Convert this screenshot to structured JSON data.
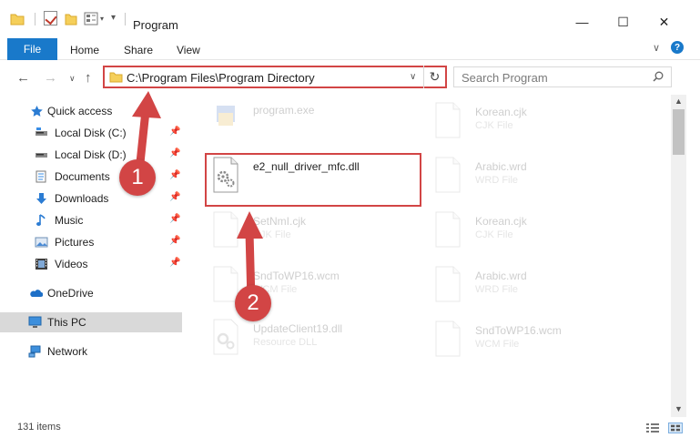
{
  "window": {
    "title": "Program",
    "minimize_glyph": "—",
    "maximize_glyph": "☐",
    "close_glyph": "✕"
  },
  "ribbon": {
    "tabs": [
      "File",
      "Home",
      "Share",
      "View"
    ],
    "help_glyph": "?"
  },
  "address": {
    "path": "C:\\Program Files\\Program Directory",
    "search_placeholder": "Search Program"
  },
  "nav": {
    "items": [
      {
        "label": "Quick access",
        "icon": "star-icon"
      },
      {
        "label": "Local Disk (C:)",
        "icon": "drive-icon",
        "pinned": true
      },
      {
        "label": "Local Disk (D:)",
        "icon": "drive-icon",
        "pinned": true
      },
      {
        "label": "Documents",
        "icon": "documents-icon",
        "pinned": true
      },
      {
        "label": "Downloads",
        "icon": "downloads-icon",
        "pinned": true
      },
      {
        "label": "Music",
        "icon": "music-icon",
        "pinned": true
      },
      {
        "label": "Pictures",
        "icon": "pictures-icon",
        "pinned": true
      },
      {
        "label": "Videos",
        "icon": "videos-icon",
        "pinned": true
      },
      {
        "label": "OneDrive",
        "icon": "onedrive-icon"
      },
      {
        "label": "This PC",
        "icon": "this-pc-icon",
        "selected": true
      },
      {
        "label": "Network",
        "icon": "network-icon"
      }
    ]
  },
  "files": {
    "col1": [
      {
        "name": "program.exe",
        "type": ""
      },
      {
        "name": "e2_null_driver_mfc.dll",
        "type": ""
      },
      {
        "name": "SetNmI.cjk",
        "type": "CJK File"
      },
      {
        "name": "SndToWP16.wcm",
        "type": "WCM File"
      },
      {
        "name": "UpdateClient19.dll",
        "type": "Resource DLL"
      }
    ],
    "col2": [
      {
        "name": "Korean.cjk",
        "type": "CJK File"
      },
      {
        "name": "Arabic.wrd",
        "type": "WRD File"
      },
      {
        "name": "Korean.cjk",
        "type": "CJK File"
      },
      {
        "name": "Arabic.wrd",
        "type": "WRD File"
      },
      {
        "name": "SndToWP16.wcm",
        "type": "WCM File"
      }
    ]
  },
  "status": {
    "item_count": "131 items"
  },
  "annotations": {
    "step1": "1",
    "step2": "2"
  },
  "colors": {
    "accent": "#1979ca",
    "annotation_red": "#d24545",
    "selected_bg": "#d9d9d9"
  }
}
